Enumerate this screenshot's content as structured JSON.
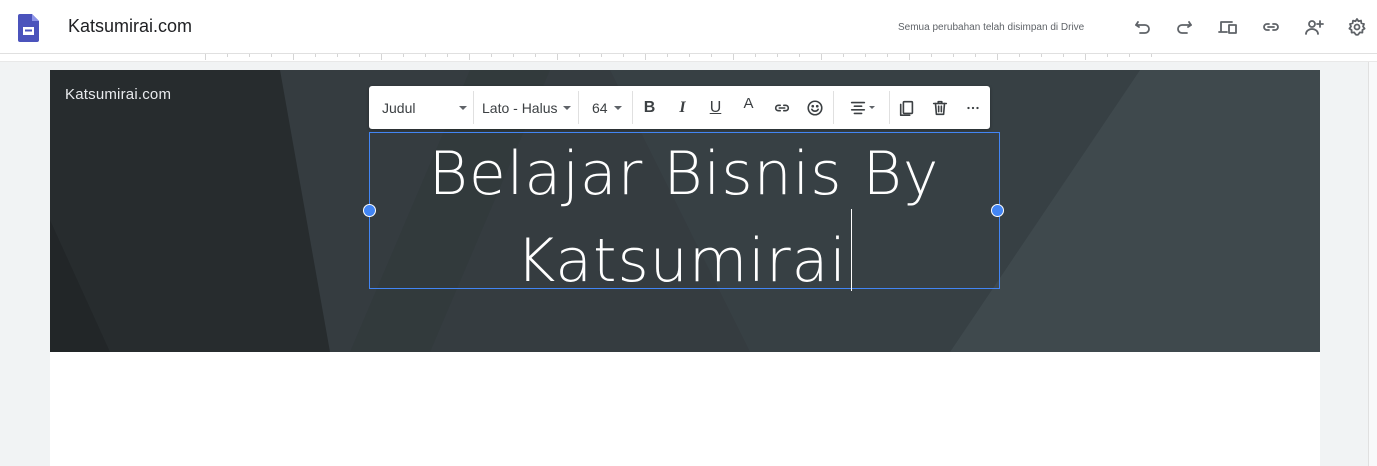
{
  "app": {
    "logo_icon": "google-sites-icon",
    "site_name": "Katsumirai.com",
    "save_status": "Semua perubahan telah disimpan di Drive"
  },
  "toolbar_icons": [
    "undo-icon",
    "redo-icon",
    "preview-device-icon",
    "link-icon",
    "share-user-icon",
    "settings-icon"
  ],
  "banner": {
    "site_label": "Katsumirai.com"
  },
  "text_toolbar": {
    "style_label": "Judul",
    "font_label": "Lato - Halus",
    "size_label": "64",
    "bold_label": "B",
    "italic_label": "I",
    "underline_label": "U",
    "color_label": "A"
  },
  "title_line1": "Belajar Bisnis By",
  "title_line2": "Katsumirai",
  "colors": {
    "accent": "#4285f4",
    "banner": "#2f3538",
    "brand": "#4b53bc"
  }
}
